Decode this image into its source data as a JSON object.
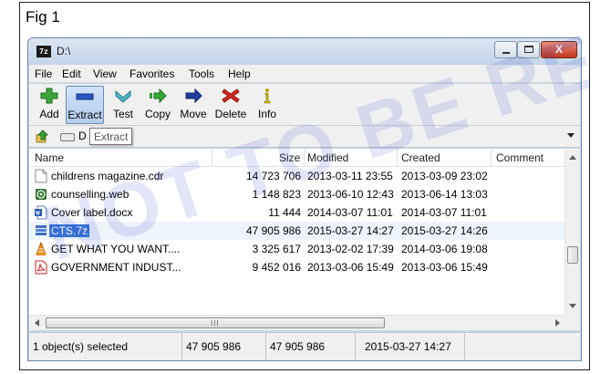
{
  "figure": {
    "label": "Fig 1",
    "watermark": "NOT TO BE REPUBLISHED"
  },
  "window": {
    "app_icon_text": "7z",
    "title": "D:\\",
    "close_glyph": "X"
  },
  "menu": [
    "File",
    "Edit",
    "View",
    "Favorites",
    "Tools",
    "Help"
  ],
  "toolbar": {
    "add": "Add",
    "extract": "Extract",
    "test": "Test",
    "copy": "Copy",
    "move": "Move",
    "delete": "Delete",
    "info": "Info"
  },
  "address": {
    "path": "D",
    "tooltip": "Extract"
  },
  "columns": {
    "name": "Name",
    "size": "Size",
    "modified": "Modified",
    "created": "Created",
    "comment": "Comment"
  },
  "files": [
    {
      "name": "childrens magazine.cdr",
      "size": "14 723 706",
      "modified": "2013-03-11 23:55",
      "created": "2013-03-09 23:02",
      "icon": "blank-file-icon"
    },
    {
      "name": "counselling.web",
      "size": "1 148 823",
      "modified": "2013-06-10 12:43",
      "created": "2013-06-14 13:03",
      "icon": "web-file-icon"
    },
    {
      "name": "Cover label.docx",
      "size": "11 444",
      "modified": "2014-03-07 11:01",
      "created": "2014-03-07 11:01",
      "icon": "word-file-icon"
    },
    {
      "name": "CTS.7z",
      "size": "47 905 986",
      "modified": "2015-03-27 14:27",
      "created": "2015-03-27 14:26",
      "icon": "archive-file-icon"
    },
    {
      "name": "GET WHAT YOU WANT....",
      "size": "3 325 617",
      "modified": "2013-02-02 17:39",
      "created": "2014-03-06 19:08",
      "icon": "vlc-file-icon"
    },
    {
      "name": "GOVERNMENT INDUST...",
      "size": "9 452 016",
      "modified": "2013-03-06 15:49",
      "created": "2013-03-06 15:49",
      "icon": "pdf-file-icon"
    }
  ],
  "selected_file_index": 3,
  "status": {
    "selection": "1 object(s) selected",
    "total_size": "47 905 986",
    "selected_size": "47 905 986",
    "modified": "2015-03-27 14:27"
  },
  "scrollbar": {
    "grip": "III"
  },
  "colors": {
    "selection": "#3875d7",
    "window_frame": "#c5d7ea",
    "close_button": "#c4351d",
    "watermark": "#233cc8"
  }
}
